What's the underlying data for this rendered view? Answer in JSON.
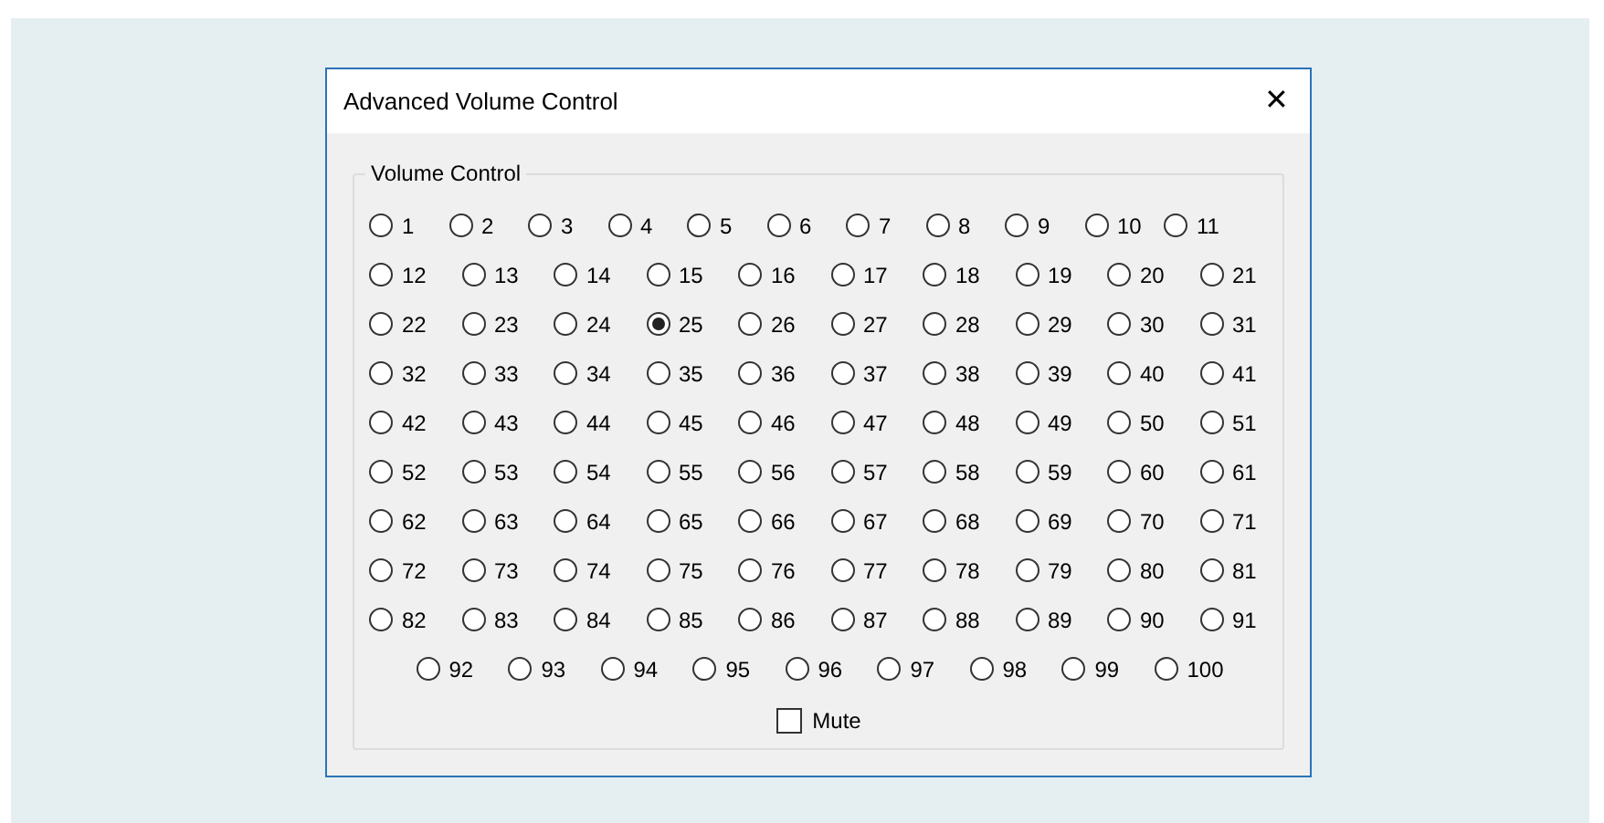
{
  "window": {
    "title": "Advanced Volume Control",
    "close": "✕"
  },
  "group": {
    "title": "Volume Control",
    "options": [
      {
        "label": "1",
        "selected": false
      },
      {
        "label": "2",
        "selected": false
      },
      {
        "label": "3",
        "selected": false
      },
      {
        "label": "4",
        "selected": false
      },
      {
        "label": "5",
        "selected": false
      },
      {
        "label": "6",
        "selected": false
      },
      {
        "label": "7",
        "selected": false
      },
      {
        "label": "8",
        "selected": false
      },
      {
        "label": "9",
        "selected": false
      },
      {
        "label": "10",
        "selected": false
      },
      {
        "label": "11",
        "selected": false
      },
      {
        "label": "12",
        "selected": false
      },
      {
        "label": "13",
        "selected": false
      },
      {
        "label": "14",
        "selected": false
      },
      {
        "label": "15",
        "selected": false
      },
      {
        "label": "16",
        "selected": false
      },
      {
        "label": "17",
        "selected": false
      },
      {
        "label": "18",
        "selected": false
      },
      {
        "label": "19",
        "selected": false
      },
      {
        "label": "20",
        "selected": false
      },
      {
        "label": "21",
        "selected": false
      },
      {
        "label": "22",
        "selected": false
      },
      {
        "label": "23",
        "selected": false
      },
      {
        "label": "24",
        "selected": false
      },
      {
        "label": "25",
        "selected": true
      },
      {
        "label": "26",
        "selected": false
      },
      {
        "label": "27",
        "selected": false
      },
      {
        "label": "28",
        "selected": false
      },
      {
        "label": "29",
        "selected": false
      },
      {
        "label": "30",
        "selected": false
      },
      {
        "label": "31",
        "selected": false
      },
      {
        "label": "32",
        "selected": false
      },
      {
        "label": "33",
        "selected": false
      },
      {
        "label": "34",
        "selected": false
      },
      {
        "label": "35",
        "selected": false
      },
      {
        "label": "36",
        "selected": false
      },
      {
        "label": "37",
        "selected": false
      },
      {
        "label": "38",
        "selected": false
      },
      {
        "label": "39",
        "selected": false
      },
      {
        "label": "40",
        "selected": false
      },
      {
        "label": "41",
        "selected": false
      },
      {
        "label": "42",
        "selected": false
      },
      {
        "label": "43",
        "selected": false
      },
      {
        "label": "44",
        "selected": false
      },
      {
        "label": "45",
        "selected": false
      },
      {
        "label": "46",
        "selected": false
      },
      {
        "label": "47",
        "selected": false
      },
      {
        "label": "48",
        "selected": false
      },
      {
        "label": "49",
        "selected": false
      },
      {
        "label": "50",
        "selected": false
      },
      {
        "label": "51",
        "selected": false
      },
      {
        "label": "52",
        "selected": false
      },
      {
        "label": "53",
        "selected": false
      },
      {
        "label": "54",
        "selected": false
      },
      {
        "label": "55",
        "selected": false
      },
      {
        "label": "56",
        "selected": false
      },
      {
        "label": "57",
        "selected": false
      },
      {
        "label": "58",
        "selected": false
      },
      {
        "label": "59",
        "selected": false
      },
      {
        "label": "60",
        "selected": false
      },
      {
        "label": "61",
        "selected": false
      },
      {
        "label": "62",
        "selected": false
      },
      {
        "label": "63",
        "selected": false
      },
      {
        "label": "64",
        "selected": false
      },
      {
        "label": "65",
        "selected": false
      },
      {
        "label": "66",
        "selected": false
      },
      {
        "label": "67",
        "selected": false
      },
      {
        "label": "68",
        "selected": false
      },
      {
        "label": "69",
        "selected": false
      },
      {
        "label": "70",
        "selected": false
      },
      {
        "label": "71",
        "selected": false
      },
      {
        "label": "72",
        "selected": false
      },
      {
        "label": "73",
        "selected": false
      },
      {
        "label": "74",
        "selected": false
      },
      {
        "label": "75",
        "selected": false
      },
      {
        "label": "76",
        "selected": false
      },
      {
        "label": "77",
        "selected": false
      },
      {
        "label": "78",
        "selected": false
      },
      {
        "label": "79",
        "selected": false
      },
      {
        "label": "80",
        "selected": false
      },
      {
        "label": "81",
        "selected": false
      },
      {
        "label": "82",
        "selected": false
      },
      {
        "label": "83",
        "selected": false
      },
      {
        "label": "84",
        "selected": false
      },
      {
        "label": "85",
        "selected": false
      },
      {
        "label": "86",
        "selected": false
      },
      {
        "label": "87",
        "selected": false
      },
      {
        "label": "88",
        "selected": false
      },
      {
        "label": "89",
        "selected": false
      },
      {
        "label": "90",
        "selected": false
      },
      {
        "label": "91",
        "selected": false
      },
      {
        "label": "92",
        "selected": false
      },
      {
        "label": "93",
        "selected": false
      },
      {
        "label": "94",
        "selected": false
      },
      {
        "label": "95",
        "selected": false
      },
      {
        "label": "96",
        "selected": false
      },
      {
        "label": "97",
        "selected": false
      },
      {
        "label": "98",
        "selected": false
      },
      {
        "label": "99",
        "selected": false
      },
      {
        "label": "100",
        "selected": false
      }
    ],
    "mute": {
      "label": "Mute",
      "checked": false
    }
  }
}
